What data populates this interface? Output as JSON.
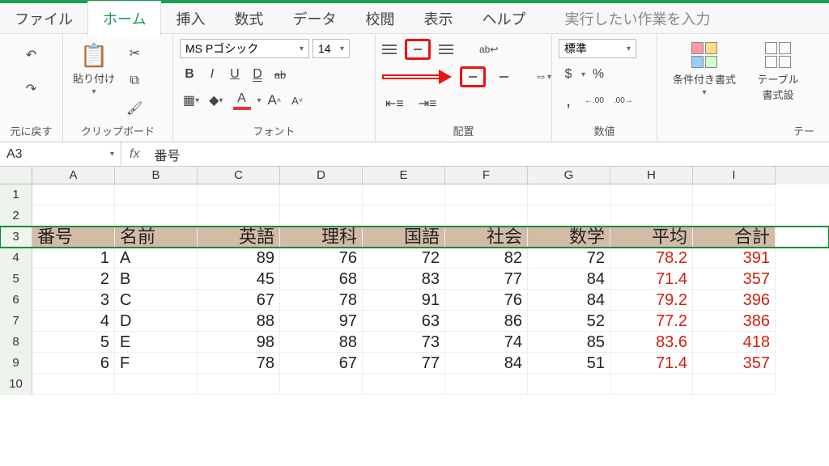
{
  "tabs": {
    "file": "ファイル",
    "home": "ホーム",
    "insert": "挿入",
    "formulas": "数式",
    "data": "データ",
    "review": "校閲",
    "view": "表示",
    "help": "ヘルプ",
    "tell_me": "実行したい作業を入力"
  },
  "ribbon": {
    "undo_label": "元に戻す",
    "clipboard": {
      "paste": "貼り付け",
      "label": "クリップボード"
    },
    "font": {
      "name": "MS Pゴシック",
      "size": "14",
      "bold": "B",
      "italic": "I",
      "underline": "U",
      "double_u": "D",
      "strike": "ab",
      "grow": "A",
      "shrink": "A",
      "color_letter": "A",
      "label": "フォント"
    },
    "alignment": {
      "wrap": "ab",
      "label": "配置"
    },
    "number": {
      "format": "標準",
      "currency": "$",
      "percent": "%",
      "comma": ",",
      "inc_dec": ".00",
      "dec_dec": ".00",
      "label": "数値"
    },
    "styles": {
      "cond_fmt": "条件付き書式",
      "table_fmt": "テーブル\n書式設",
      "label": "テー"
    }
  },
  "namebox": "A3",
  "fx": "fx",
  "formula": "番号",
  "columns": [
    "A",
    "B",
    "C",
    "D",
    "E",
    "F",
    "G",
    "H",
    "I"
  ],
  "row_numbers": [
    "1",
    "2",
    "3",
    "4",
    "5",
    "6",
    "7",
    "8",
    "9",
    "10"
  ],
  "header_row": [
    "番号",
    "名前",
    "英語",
    "理科",
    "国語",
    "社会",
    "数学",
    "平均",
    "合計"
  ],
  "chart_data": {
    "type": "table",
    "columns": [
      "番号",
      "名前",
      "英語",
      "理科",
      "国語",
      "社会",
      "数学",
      "平均",
      "合計"
    ],
    "rows": [
      {
        "番号": 1,
        "名前": "A",
        "英語": 89,
        "理科": 76,
        "国語": 72,
        "社会": 82,
        "数学": 72,
        "平均": 78.2,
        "合計": 391
      },
      {
        "番号": 2,
        "名前": "B",
        "英語": 45,
        "理科": 68,
        "国語": 83,
        "社会": 77,
        "数学": 84,
        "平均": 71.4,
        "合計": 357
      },
      {
        "番号": 3,
        "名前": "C",
        "英語": 67,
        "理科": 78,
        "国語": 91,
        "社会": 76,
        "数学": 84,
        "平均": 79.2,
        "合計": 396
      },
      {
        "番号": 4,
        "名前": "D",
        "英語": 88,
        "理科": 97,
        "国語": 63,
        "社会": 86,
        "数学": 52,
        "平均": 77.2,
        "合計": 386
      },
      {
        "番号": 5,
        "名前": "E",
        "英語": 98,
        "理科": 88,
        "国語": 73,
        "社会": 74,
        "数学": 85,
        "平均": 83.6,
        "合計": 418
      },
      {
        "番号": 6,
        "名前": "F",
        "英語": 78,
        "理科": 67,
        "国語": 77,
        "社会": 84,
        "数学": 51,
        "平均": 71.4,
        "合計": 357
      }
    ]
  },
  "data_rows": [
    [
      "1",
      "A",
      "89",
      "76",
      "72",
      "82",
      "72",
      "78.2",
      "391"
    ],
    [
      "2",
      "B",
      "45",
      "68",
      "83",
      "77",
      "84",
      "71.4",
      "357"
    ],
    [
      "3",
      "C",
      "67",
      "78",
      "91",
      "76",
      "84",
      "79.2",
      "396"
    ],
    [
      "4",
      "D",
      "88",
      "97",
      "63",
      "86",
      "52",
      "77.2",
      "386"
    ],
    [
      "5",
      "E",
      "98",
      "88",
      "73",
      "74",
      "85",
      "83.6",
      "418"
    ],
    [
      "6",
      "F",
      "78",
      "67",
      "77",
      "84",
      "51",
      "71.4",
      "357"
    ]
  ]
}
